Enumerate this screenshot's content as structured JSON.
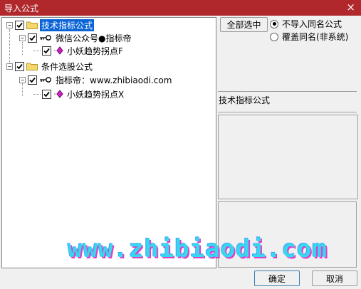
{
  "window": {
    "title": "导入公式",
    "close_glyph": "×"
  },
  "tree": {
    "nodes": [
      {
        "label": "技术指标公式",
        "checked": true,
        "expanded": true,
        "selected": true
      },
      {
        "label": "微信公众号●指标帝",
        "checked": true,
        "expanded": true
      },
      {
        "label": "小妖趋势拐点F",
        "checked": true
      },
      {
        "label": "条件选股公式",
        "checked": true,
        "expanded": true
      },
      {
        "label": "指标帝：www.zhibiaodi.com",
        "checked": true,
        "expanded": true
      },
      {
        "label": "小妖趋势拐点X",
        "checked": true
      }
    ]
  },
  "options": {
    "select_all_label": "全部选中",
    "radio_no_import": "不导入同名公式",
    "radio_overwrite": "覆盖同名(非系统)",
    "selected_radio": "radio_no_import"
  },
  "detail": {
    "type_label": "技术指标公式"
  },
  "footer": {
    "ok_label": "确定",
    "cancel_label": "取消"
  },
  "watermark": {
    "text": "www.zhibiaodi.com"
  },
  "colors": {
    "titlebar": "#b0282c",
    "selection": "#0a64d6"
  }
}
